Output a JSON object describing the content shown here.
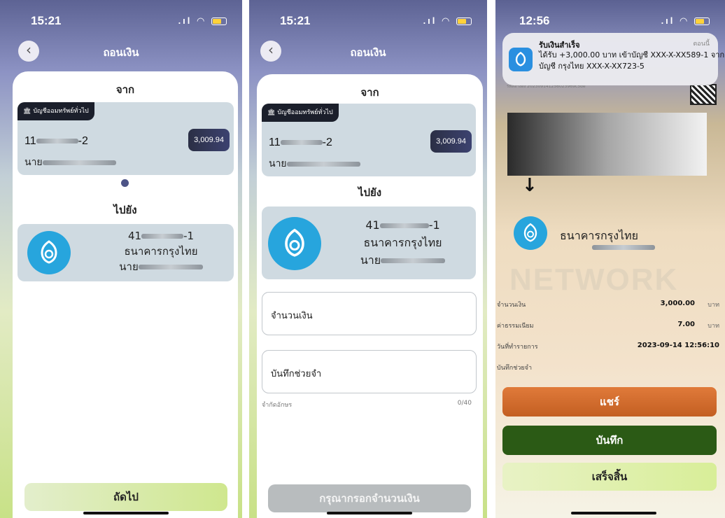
{
  "screen1": {
    "time": "15:21",
    "title": "ถอนเงิน",
    "from_label": "จาก",
    "account_tag": "บัญชีออมทรัพย์ทั่วไป",
    "account_prefix": "11",
    "account_suffix": "-2",
    "balance": "3,009.94",
    "owner_prefix": "นาย",
    "to_label": "ไปยัง",
    "dest_prefix": "41",
    "dest_suffix": "-1",
    "dest_bank": "ธนาคารกรุงไทย",
    "dest_owner_prefix": "นาย",
    "next_label": "ถัดไป"
  },
  "screen2": {
    "time": "15:21",
    "title": "ถอนเงิน",
    "from_label": "จาก",
    "account_tag": "บัญชีออมทรัพย์ทั่วไป",
    "account_prefix": "11",
    "account_suffix": "-2",
    "balance": "3,009.94",
    "owner_prefix": "นาย",
    "to_label": "ไปยัง",
    "dest_prefix": "41",
    "dest_suffix": "-1",
    "dest_bank": "ธนาคารกรุงไทย",
    "dest_owner_prefix": "นาย",
    "amount_label": "จำนวนเงิน",
    "memo_label": "บันทึกช่วยจำ",
    "char_limit_label": "จำกัดอักษร",
    "char_count": "0/40",
    "submit_label": "กรุณากรอกจำนวนเงิน"
  },
  "screen3": {
    "time": "12:56",
    "notification": {
      "title": "รับเงินสำเร็จ",
      "when": "ตอนนี้",
      "body": "ได้รับ +3,000.00 บาท เข้าบัญชี XXX-X-XX589-1 จากบัญชี กรุงไทย XXX-X-XX723-5"
    },
    "ref_text": "รหัสอ้างอิง 202309141256023969c5de",
    "arrow": "↓",
    "dest_bank": "ธนาคารกรุงไทย",
    "watermark": "NETWORK",
    "rows": [
      {
        "label": "จำนวนเงิน",
        "value": "3,000.00",
        "unit": "บาท"
      },
      {
        "label": "ค่าธรรมเนียม",
        "value": "7.00",
        "unit": "บาท"
      },
      {
        "label": "วันที่ทำรายการ",
        "value": "2023-09-14 12:56:10",
        "unit": ""
      },
      {
        "label": "บันทึกช่วยจำ",
        "value": "",
        "unit": ""
      }
    ],
    "share_label": "แชร์",
    "save_label": "บันทึก",
    "done_label": "เสร็จสิ้น"
  },
  "colors": {
    "accent_dark": "#1b1f2b",
    "bank_blue": "#27a5dd",
    "share_orange": "#cf6a2b",
    "save_green": "#2b5a15",
    "done_lime": "#dff1a9"
  }
}
